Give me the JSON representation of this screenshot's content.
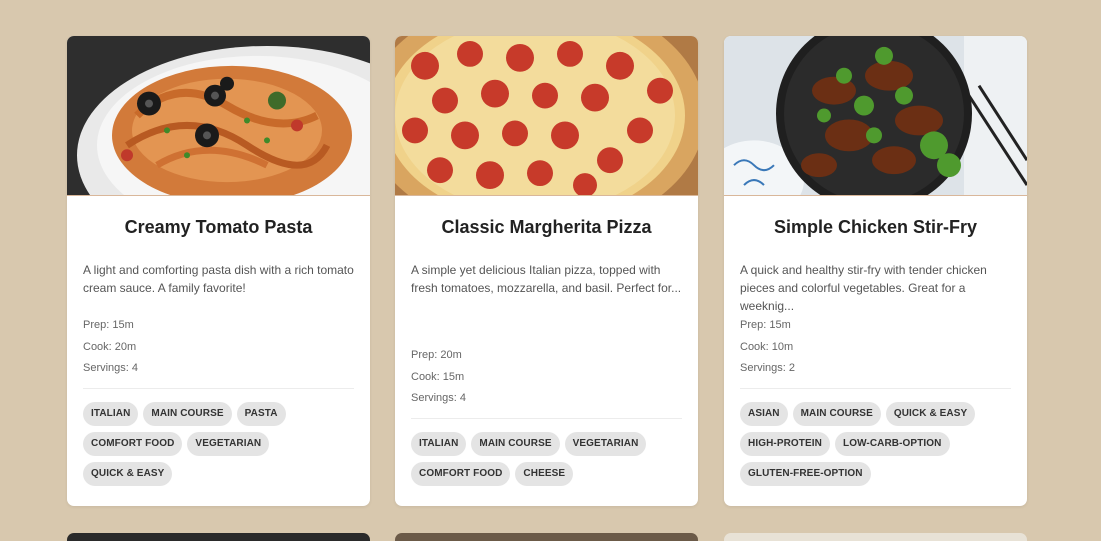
{
  "recipes": [
    {
      "title": "Creamy Tomato Pasta",
      "description": "A light and comforting pasta dish with a rich tomato cream sauce. A family favorite!",
      "prep": "Prep: 15m",
      "cook": "Cook: 20m",
      "servings": "Servings: 4",
      "tags": [
        "ITALIAN",
        "MAIN COURSE",
        "PASTA",
        "COMFORT FOOD",
        "VEGETARIAN",
        "QUICK & EASY"
      ]
    },
    {
      "title": "Classic Margherita Pizza",
      "description": "A simple yet delicious Italian pizza, topped with fresh tomatoes, mozzarella, and basil. Perfect for...",
      "prep": "Prep: 20m",
      "cook": "Cook: 15m",
      "servings": "Servings: 4",
      "tags": [
        "ITALIAN",
        "MAIN COURSE",
        "VEGETARIAN",
        "COMFORT FOOD",
        "CHEESE"
      ]
    },
    {
      "title": "Simple Chicken Stir-Fry",
      "description": "A quick and healthy stir-fry with tender chicken pieces and colorful vegetables. Great for a weeknig...",
      "prep": "Prep: 15m",
      "cook": "Cook: 10m",
      "servings": "Servings: 2",
      "tags": [
        "ASIAN",
        "MAIN COURSE",
        "QUICK & EASY",
        "HIGH-PROTEIN",
        "LOW-CARB-OPTION",
        "GLUTEN-FREE-OPTION"
      ]
    }
  ],
  "colors": {
    "page_background": "#d8c8ae",
    "card_background": "#ffffff",
    "tag_background": "#e4e4e4"
  }
}
